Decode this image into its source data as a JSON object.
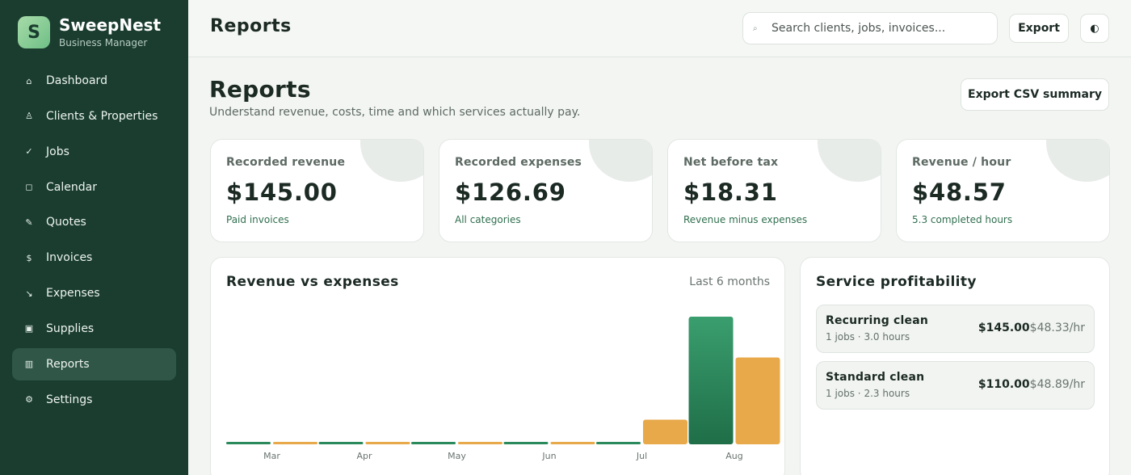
{
  "brand": {
    "logo_letter": "S",
    "name": "SweepNest",
    "subtitle": "Business Manager"
  },
  "sidebar": {
    "items": [
      {
        "label": "Dashboard",
        "icon": "home-icon",
        "glyph": "⌂"
      },
      {
        "label": "Clients & Properties",
        "icon": "user-icon",
        "glyph": "♙"
      },
      {
        "label": "Jobs",
        "icon": "check-icon",
        "glyph": "✓"
      },
      {
        "label": "Calendar",
        "icon": "calendar-icon",
        "glyph": "◻"
      },
      {
        "label": "Quotes",
        "icon": "pencil-icon",
        "glyph": "✎"
      },
      {
        "label": "Invoices",
        "icon": "dollar-icon",
        "glyph": "$"
      },
      {
        "label": "Expenses",
        "icon": "trend-down-icon",
        "glyph": "↘"
      },
      {
        "label": "Supplies",
        "icon": "box-icon",
        "glyph": "▣"
      },
      {
        "label": "Reports",
        "icon": "report-icon",
        "glyph": "▥",
        "active": true
      },
      {
        "label": "Settings",
        "icon": "gear-icon",
        "glyph": "⚙"
      }
    ]
  },
  "topbar": {
    "title": "Reports",
    "search_placeholder": "Search clients, jobs, invoices...",
    "search_icon": "⌕",
    "export_label": "Export",
    "theme_glyph": "◐"
  },
  "page": {
    "title": "Reports",
    "subtitle": "Understand revenue, costs, time and which services actually pay.",
    "csv_label": "Export CSV summary"
  },
  "stats": [
    {
      "label": "Recorded revenue",
      "value": "$145.00",
      "note": "Paid invoices"
    },
    {
      "label": "Recorded expenses",
      "value": "$126.69",
      "note": "All categories"
    },
    {
      "label": "Net before tax",
      "value": "$18.31",
      "note": "Revenue minus expenses"
    },
    {
      "label": "Revenue / hour",
      "value": "$48.57",
      "note": "5.3 completed hours"
    }
  ],
  "chart": {
    "title": "Revenue vs expenses",
    "range_label": "Last 6 months"
  },
  "chart_data": {
    "type": "bar",
    "categories": [
      "Mar",
      "Apr",
      "May",
      "Jun",
      "Jul",
      "Aug"
    ],
    "series": [
      {
        "values": [
          0,
          0,
          0,
          0,
          0,
          145.0
        ],
        "color": "#2a8a5c"
      },
      {
        "values": [
          0,
          0,
          0,
          0,
          28,
          98.69
        ],
        "color": "#e8a94a"
      }
    ],
    "ylim": [
      0,
      145
    ],
    "grid": false,
    "legend": "none"
  },
  "services": {
    "title": "Service profitability",
    "rows": [
      {
        "name": "Recurring clean",
        "meta": "1 jobs · 3.0 hours",
        "amount": "$145.00",
        "rate": "$48.33/hr"
      },
      {
        "name": "Standard clean",
        "meta": "1 jobs · 2.3 hours",
        "amount": "$110.00",
        "rate": "$48.89/hr"
      }
    ]
  },
  "colors": {
    "sidebar": "#1a3d2f",
    "revenue": "#2a8a5c",
    "expenses": "#e8a94a",
    "accent_text": "#2f6f4e"
  }
}
